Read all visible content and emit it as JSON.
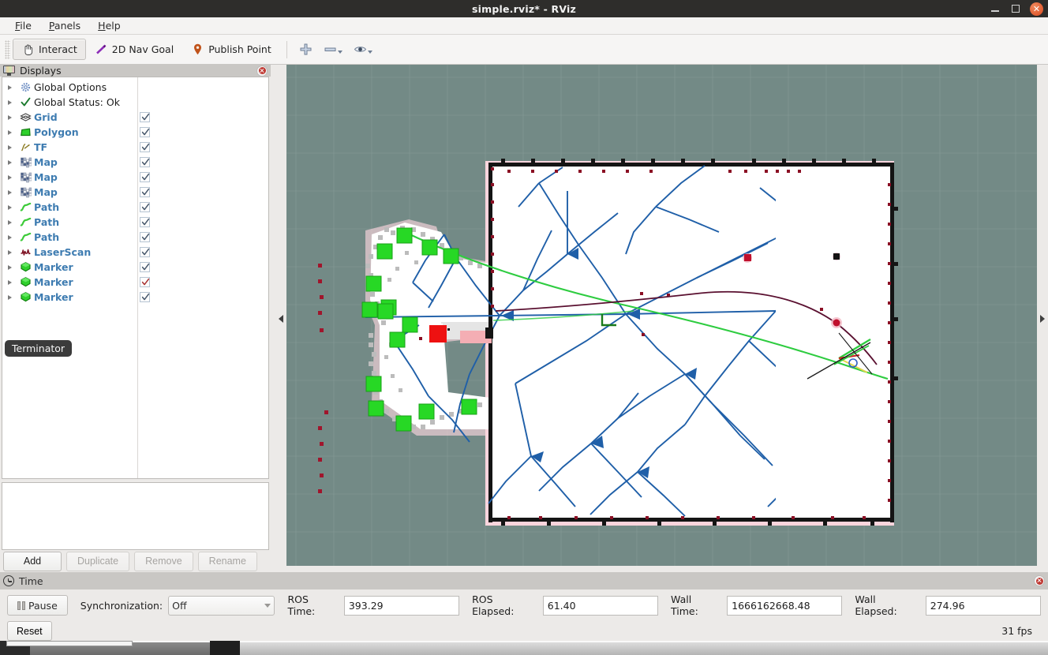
{
  "window": {
    "title": "simple.rviz* - RViz",
    "minimize_icon": "minimize-icon",
    "maximize_icon": "maximize-icon",
    "close_icon": "close-icon",
    "close_glyph": "✕"
  },
  "menubar": {
    "items": [
      {
        "label": "File",
        "mnemonic": "F",
        "rest": "ile"
      },
      {
        "label": "Panels",
        "mnemonic": "P",
        "rest": "anels"
      },
      {
        "label": "Help",
        "mnemonic": "H",
        "rest": "elp"
      }
    ]
  },
  "toolbar": {
    "interact": "Interact",
    "nav_goal": "2D Nav Goal",
    "publish_point": "Publish Point",
    "zoom_in_icon": "plus-icon",
    "zoom_out_icon": "minus-icon",
    "focus_icon": "eye-icon"
  },
  "displays": {
    "title": "Displays",
    "panel_icon": "monitor-icon",
    "close_icon": "close-icon",
    "tooltip": "Terminator",
    "items": [
      {
        "label": "Global Options",
        "icon": "gear-icon",
        "checkbox": "none",
        "bold": false
      },
      {
        "label": "Global Status: Ok",
        "icon": "checkmark-icon",
        "checkbox": "none",
        "bold": false
      },
      {
        "label": "Grid",
        "icon": "grid-icon",
        "checkbox": "dark",
        "bold": true
      },
      {
        "label": "Polygon",
        "icon": "polygon-icon",
        "checkbox": "dark",
        "bold": true
      },
      {
        "label": "TF",
        "icon": "tf-icon",
        "checkbox": "dark",
        "bold": true
      },
      {
        "label": "Map",
        "icon": "map-icon",
        "checkbox": "dark",
        "bold": true
      },
      {
        "label": "Map",
        "icon": "map-icon",
        "checkbox": "dark",
        "bold": true
      },
      {
        "label": "Map",
        "icon": "map-icon",
        "checkbox": "dark",
        "bold": true
      },
      {
        "label": "Path",
        "icon": "path-icon",
        "checkbox": "dark",
        "bold": true
      },
      {
        "label": "Path",
        "icon": "path-icon",
        "checkbox": "dark",
        "bold": true
      },
      {
        "label": "Path",
        "icon": "path-icon",
        "checkbox": "dark",
        "bold": true
      },
      {
        "label": "LaserScan",
        "icon": "laserscan-icon",
        "checkbox": "dark",
        "bold": true
      },
      {
        "label": "Marker",
        "icon": "marker-icon",
        "checkbox": "dark",
        "bold": true
      },
      {
        "label": "Marker",
        "icon": "marker-icon",
        "checkbox": "red",
        "bold": true
      },
      {
        "label": "Marker",
        "icon": "marker-icon",
        "checkbox": "dark",
        "bold": true
      }
    ],
    "buttons": {
      "add": "Add",
      "duplicate": "Duplicate",
      "remove": "Remove",
      "rename": "Rename"
    }
  },
  "time": {
    "title": "Time",
    "panel_icon": "clock-icon",
    "close_icon": "close-icon",
    "pause_label": "Pause",
    "pause_icon": "pause-icon",
    "sync_label": "Synchronization:",
    "sync_value": "Off",
    "ros_time_label": "ROS Time:",
    "ros_time_value": "393.29",
    "ros_elapsed_label": "ROS Elapsed:",
    "ros_elapsed_value": "61.40",
    "wall_time_label": "Wall Time:",
    "wall_time_value": "1666162668.48",
    "wall_elapsed_label": "Wall Elapsed:",
    "wall_elapsed_value": "274.96",
    "reset_label": "Reset",
    "fps": "31 fps"
  },
  "view": {
    "background_color": "#738a86",
    "grid_color": "#8fa19d",
    "map_free_color": "#ffffff",
    "map_wall_color": "#1a1a1a",
    "inflation_color": "#fbd5dd",
    "tree_color": "#1f5fa8",
    "frontier_marker_color": "#27d825",
    "robot_marker_color": "#ee1111",
    "laser_color": "#8b0f24",
    "path_green_color": "#2ecc40",
    "path_dark_color": "#5a1030",
    "collapse_left_icon": "collapse-left-icon",
    "collapse_right_icon": "collapse-right-icon"
  }
}
